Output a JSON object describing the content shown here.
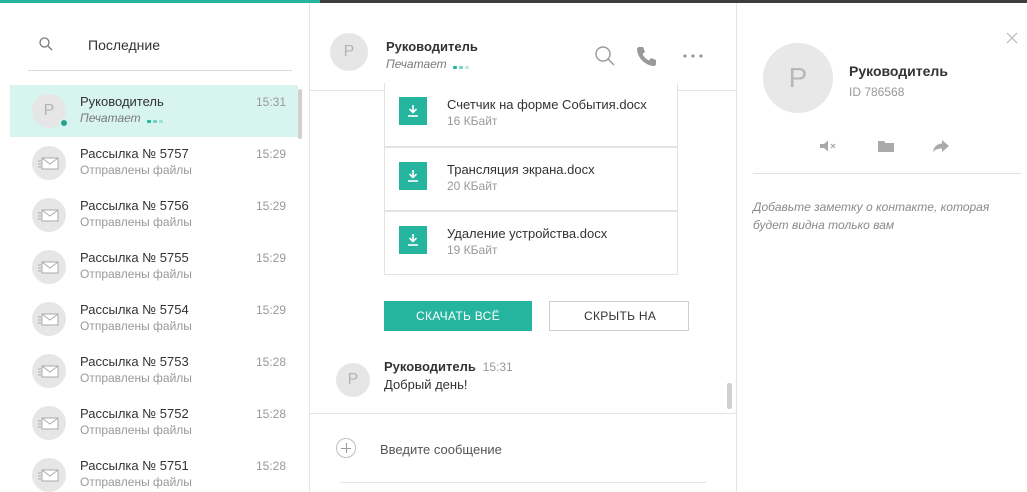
{
  "sidebar": {
    "search_label": "Последние",
    "items": [
      {
        "avatar_letter": "P",
        "name": "Руководитель",
        "sub": "Печатает",
        "time": "15:31",
        "active": true,
        "online": true
      },
      {
        "name": "Рассылка № 5757",
        "sub": "Отправлены файлы",
        "time": "15:29"
      },
      {
        "name": "Рассылка № 5756",
        "sub": "Отправлены файлы",
        "time": "15:29"
      },
      {
        "name": "Рассылка № 5755",
        "sub": "Отправлены файлы",
        "time": "15:29"
      },
      {
        "name": "Рассылка № 5754",
        "sub": "Отправлены файлы",
        "time": "15:29"
      },
      {
        "name": "Рассылка № 5753",
        "sub": "Отправлены файлы",
        "time": "15:28"
      },
      {
        "name": "Рассылка № 5752",
        "sub": "Отправлены файлы",
        "time": "15:28"
      },
      {
        "name": "Рассылка № 5751",
        "sub": "Отправлены файлы",
        "time": "15:28"
      }
    ]
  },
  "chat": {
    "avatar_letter": "P",
    "title": "Руководитель",
    "status": "Печатает",
    "files": [
      {
        "name": "Счетчик на форме События.docx",
        "size": "16 КБайт"
      },
      {
        "name": "Трансляция экрана.docx",
        "size": "20 КБайт"
      },
      {
        "name": "Удаление устройства.docx",
        "size": "19 КБайт"
      }
    ],
    "download_all": "СКАЧАТЬ ВСЁ",
    "hide": "СКРЫТЬ НА",
    "message": {
      "avatar_letter": "P",
      "author": "Руководитель",
      "time": "15:31",
      "text": "Добрый день!"
    },
    "compose_placeholder": "Введите сообщение"
  },
  "contact": {
    "avatar_letter": "P",
    "name": "Руководитель",
    "id": "ID 786568",
    "note": "Добавьте заметку о контакте, которая будет видна только вам"
  },
  "colors": {
    "accent": "#25b59e",
    "active_row": "#d8f4ee"
  }
}
